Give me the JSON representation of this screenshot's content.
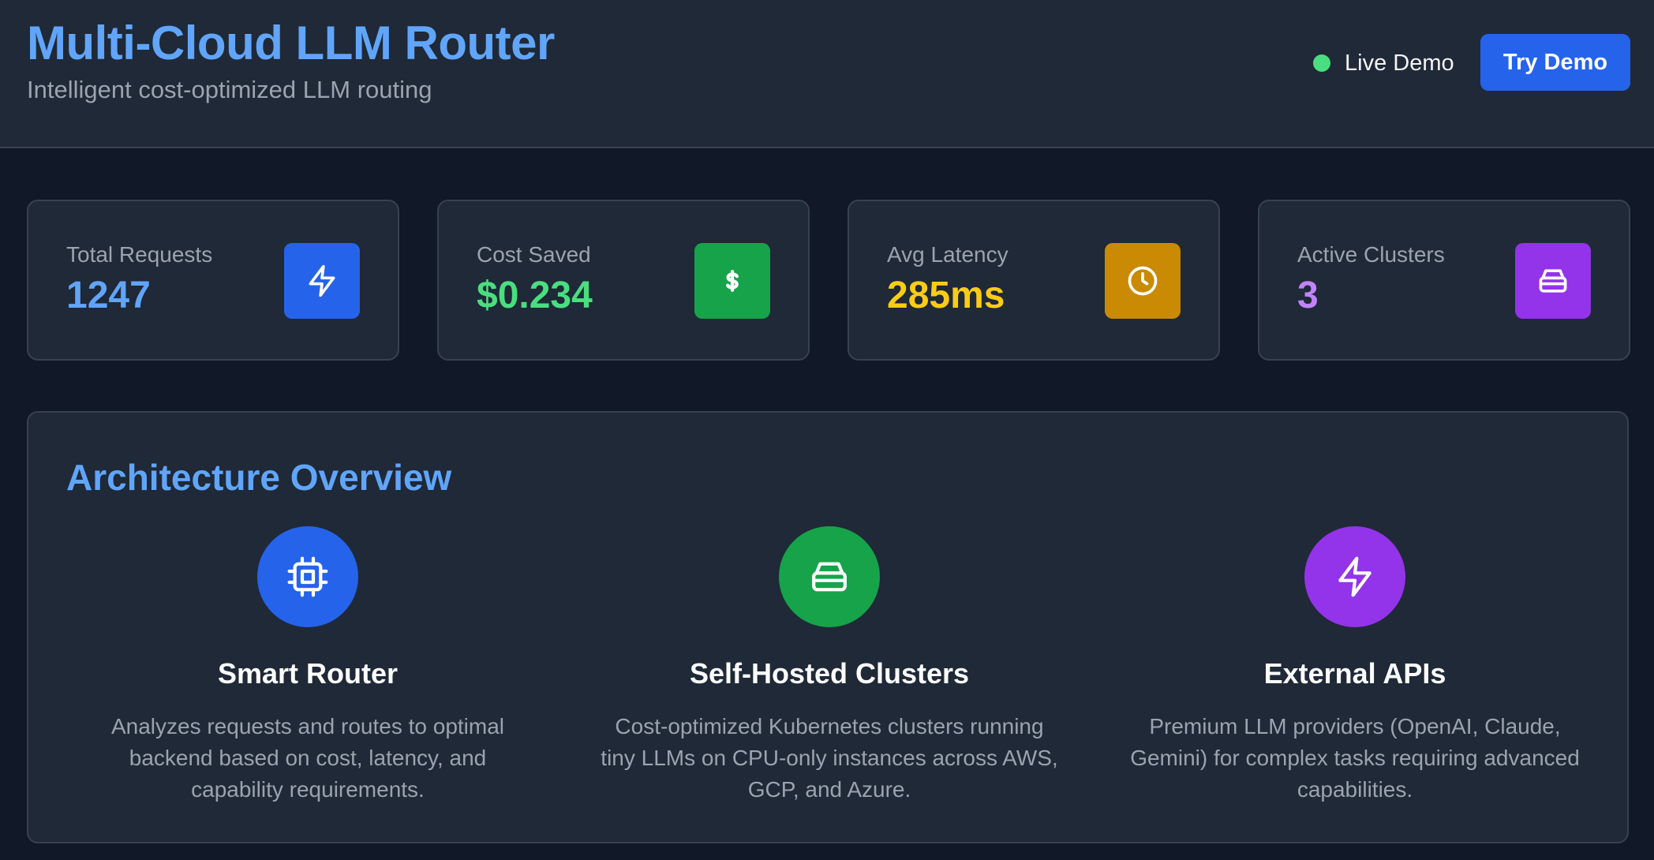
{
  "header": {
    "title": "Multi-Cloud LLM Router",
    "subtitle": "Intelligent cost-optimized LLM routing",
    "live_label": "Live Demo",
    "try_button": "Try Demo"
  },
  "stats": [
    {
      "label": "Total Requests",
      "value": "1247",
      "icon": "lightning-icon",
      "value_color": "#60a5fa",
      "icon_bg": "#2563eb"
    },
    {
      "label": "Cost Saved",
      "value": "$0.234",
      "icon": "dollar-icon",
      "value_color": "#4ade80",
      "icon_bg": "#16a34a"
    },
    {
      "label": "Avg Latency",
      "value": "285ms",
      "icon": "clock-icon",
      "value_color": "#facc15",
      "icon_bg": "#ca8a04"
    },
    {
      "label": "Active Clusters",
      "value": "3",
      "icon": "server-icon",
      "value_color": "#c084fc",
      "icon_bg": "#9333ea"
    }
  ],
  "architecture": {
    "title": "Architecture Overview",
    "items": [
      {
        "name": "Smart Router",
        "icon": "chip-icon",
        "color": "#2563eb",
        "desc_lines": [
          "Analyzes requests and routes to optimal",
          "backend based on cost, latency, and",
          "capability requirements."
        ]
      },
      {
        "name": "Self-Hosted Clusters",
        "icon": "server-icon",
        "color": "#16a34a",
        "desc_lines": [
          "Cost-optimized Kubernetes clusters running",
          "tiny LLMs on CPU-only instances across AWS,",
          "GCP, and Azure."
        ]
      },
      {
        "name": "External APIs",
        "icon": "lightning-icon",
        "color": "#9333ea",
        "desc_lines": [
          "Premium LLM providers (OpenAI, Claude,",
          "Gemini) for complex tasks requiring advanced",
          "capabilities."
        ]
      }
    ]
  },
  "colors": {
    "background": "#111827",
    "panel": "#1f2937",
    "accent": "#60a5fa",
    "live_dot": "#4ade80"
  }
}
